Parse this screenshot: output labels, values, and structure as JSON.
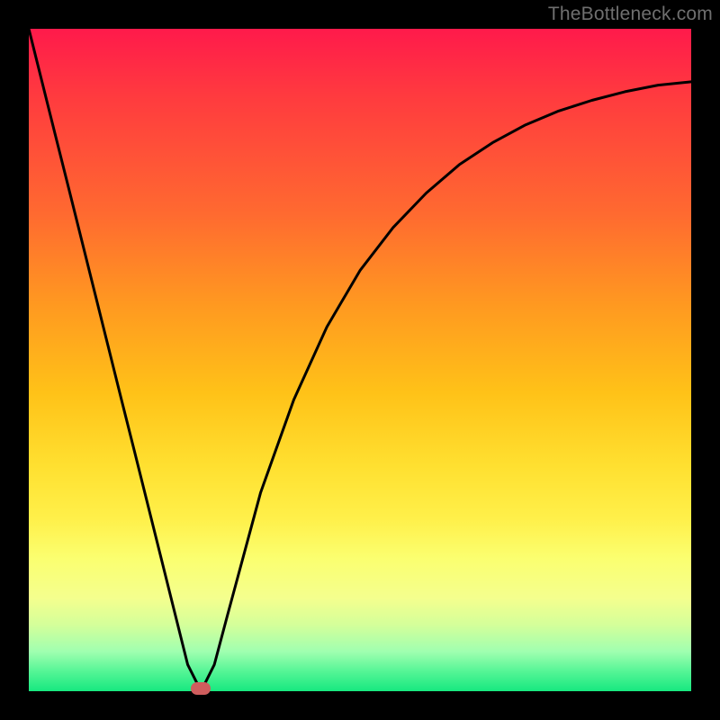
{
  "watermark": "TheBottleneck.com",
  "colors": {
    "background": "#000000",
    "gradient_top": "#ff1a4b",
    "gradient_bottom": "#17e880",
    "curve": "#000000",
    "marker": "#cf5d5d",
    "watermark": "#6f6f6f"
  },
  "chart_data": {
    "type": "line",
    "title": "",
    "xlabel": "",
    "ylabel": "",
    "x": [
      0.0,
      0.02,
      0.04,
      0.06,
      0.08,
      0.1,
      0.12,
      0.14,
      0.16,
      0.18,
      0.2,
      0.22,
      0.24,
      0.26,
      0.28,
      0.3,
      0.35,
      0.4,
      0.45,
      0.5,
      0.55,
      0.6,
      0.65,
      0.7,
      0.75,
      0.8,
      0.85,
      0.9,
      0.95,
      1.0
    ],
    "y": [
      1.0,
      0.92,
      0.84,
      0.76,
      0.68,
      0.6,
      0.52,
      0.44,
      0.36,
      0.28,
      0.2,
      0.12,
      0.04,
      0.0,
      0.04,
      0.115,
      0.3,
      0.44,
      0.55,
      0.635,
      0.7,
      0.752,
      0.795,
      0.828,
      0.855,
      0.876,
      0.892,
      0.905,
      0.915,
      0.92
    ],
    "xlim": [
      0,
      1
    ],
    "ylim": [
      0,
      1
    ],
    "marker": {
      "x": 0.26,
      "y": 0.0
    },
    "note": "Values are normalized to the visible plot area (0..1 in each axis). y=1 is the top edge, y=0 is the bottom edge. Curve descends linearly from top-left to the minimum near x≈0.26, then rises with diminishing slope toward the right edge."
  }
}
